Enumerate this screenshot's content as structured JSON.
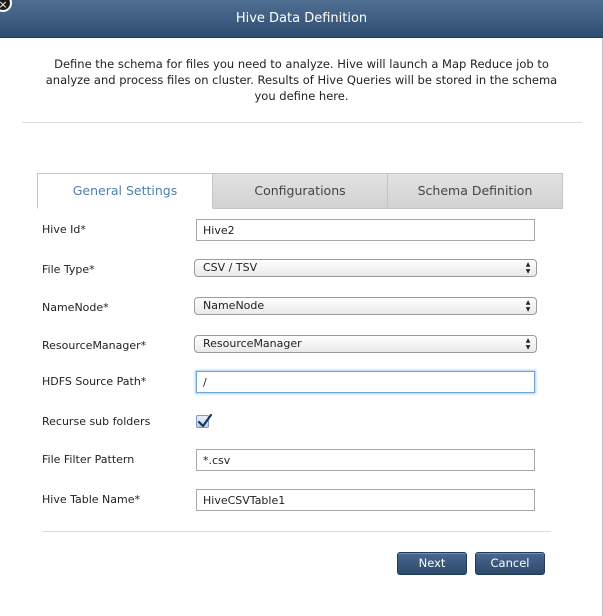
{
  "dialog": {
    "title": "Hive Data Definition",
    "close_glyph": "×",
    "description": "Define the schema for files you need to analyze. Hive will launch a Map Reduce job to analyze and process files on cluster. Results of Hive Queries will be stored in the schema you define here."
  },
  "tabs": [
    {
      "label": "General Settings",
      "active": true
    },
    {
      "label": "Configurations",
      "active": false
    },
    {
      "label": "Schema Definition",
      "active": false
    }
  ],
  "form": {
    "hive_id": {
      "label": "Hive Id*",
      "value": "Hive2"
    },
    "file_type": {
      "label": "File Type*",
      "value": "CSV / TSV"
    },
    "name_node": {
      "label": "NameNode*",
      "value": "NameNode"
    },
    "resource_manager": {
      "label": "ResourceManager*",
      "value": "ResourceManager"
    },
    "hdfs_source_path": {
      "label": "HDFS Source Path*",
      "value": "/"
    },
    "recurse_sub_folders": {
      "label": "Recurse sub folders",
      "checked": true
    },
    "file_filter_pattern": {
      "label": "File Filter Pattern",
      "value": "*.csv"
    },
    "hive_table_name": {
      "label": "Hive Table Name*",
      "value": "HiveCSVTable1"
    }
  },
  "buttons": {
    "next_label": "Next",
    "cancel_label": "Cancel"
  },
  "colors": {
    "titlebar": "#3b5a7e",
    "active_tab_text": "#4d7fb3",
    "button": "#3a5a80"
  },
  "icons": {
    "select_arrows": "select-arrows-icon",
    "checkmark": "checkmark-icon",
    "close": "close-icon"
  }
}
